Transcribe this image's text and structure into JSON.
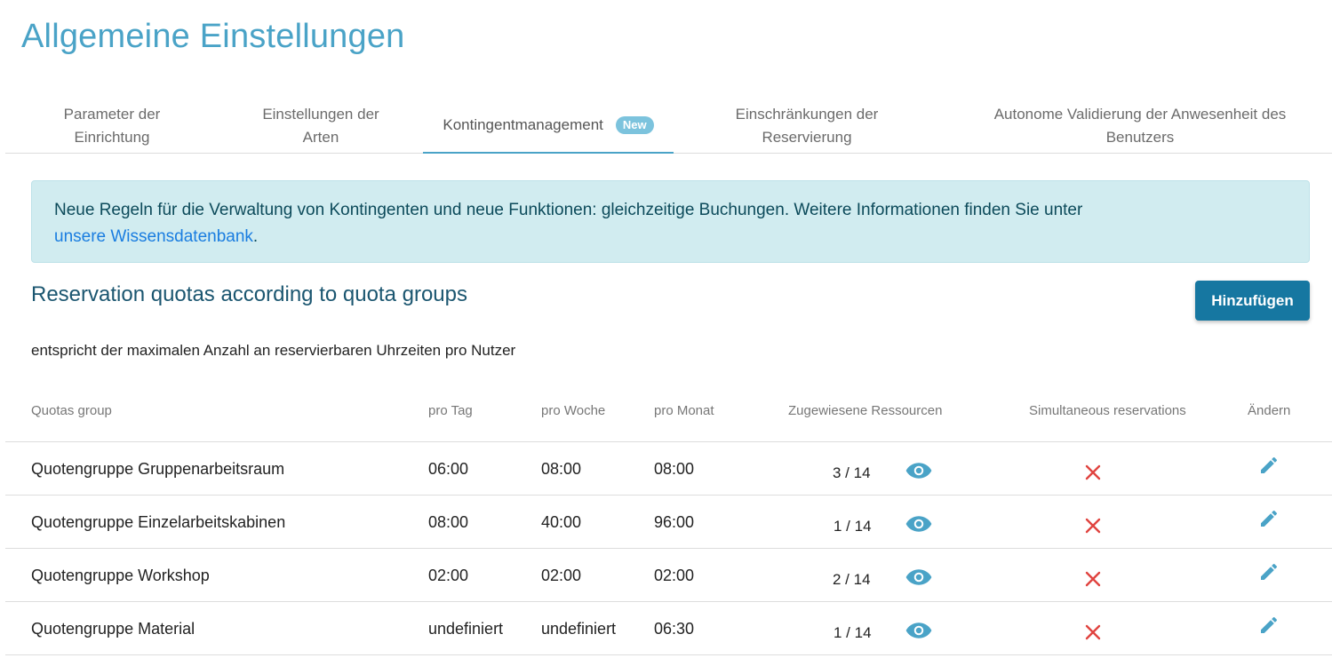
{
  "page": {
    "title": "Allgemeine Einstellungen"
  },
  "tabs": [
    {
      "label": "Parameter der\nEinrichtung"
    },
    {
      "label": "Einstellungen der\nArten"
    },
    {
      "label": "Kontingentmanagement",
      "badge": "New",
      "active": true
    },
    {
      "label": "Einschränkungen der\nReservierung"
    },
    {
      "label": "Autonome Validierung der Anwesenheit des\nBenutzers"
    }
  ],
  "alert": {
    "text": "Neue Regeln für die Verwaltung von Kontingenten und neue Funktionen: gleichzeitige Buchungen. Weitere Informationen finden Sie unter",
    "link": "unsere Wissensdatenbank",
    "suffix": "."
  },
  "section": {
    "title": "Reservation quotas according to quota groups",
    "add_button": "Hinzufügen",
    "description": "entspricht der maximalen Anzahl an reservierbaren Uhrzeiten pro Nutzer"
  },
  "table": {
    "headers": {
      "group": "Quotas group",
      "day": "pro Tag",
      "week": "pro Woche",
      "month": "pro Monat",
      "resources": "Zugewiesene Ressourcen",
      "simultaneous": "Simultaneous reservations",
      "edit": "Ändern"
    },
    "rows": [
      {
        "group": "Quotengruppe Gruppenarbeitsraum",
        "day": "06:00",
        "week": "08:00",
        "month": "08:00",
        "resources": "3 / 14",
        "simultaneous": false
      },
      {
        "group": "Quotengruppe Einzelarbeitskabinen",
        "day": "08:00",
        "week": "40:00",
        "month": "96:00",
        "resources": "1 / 14",
        "simultaneous": false
      },
      {
        "group": "Quotengruppe Workshop",
        "day": "02:00",
        "week": "02:00",
        "month": "02:00",
        "resources": "2 / 14",
        "simultaneous": false
      },
      {
        "group": "Quotengruppe Material",
        "day": "undefiniert",
        "week": "undefiniert",
        "month": "06:30",
        "resources": "1 / 14",
        "simultaneous": false
      }
    ]
  },
  "colors": {
    "accent": "#4aa3c7",
    "button": "#1677a1",
    "alert_bg": "#d1ecf0",
    "cross": "#e0433f"
  }
}
